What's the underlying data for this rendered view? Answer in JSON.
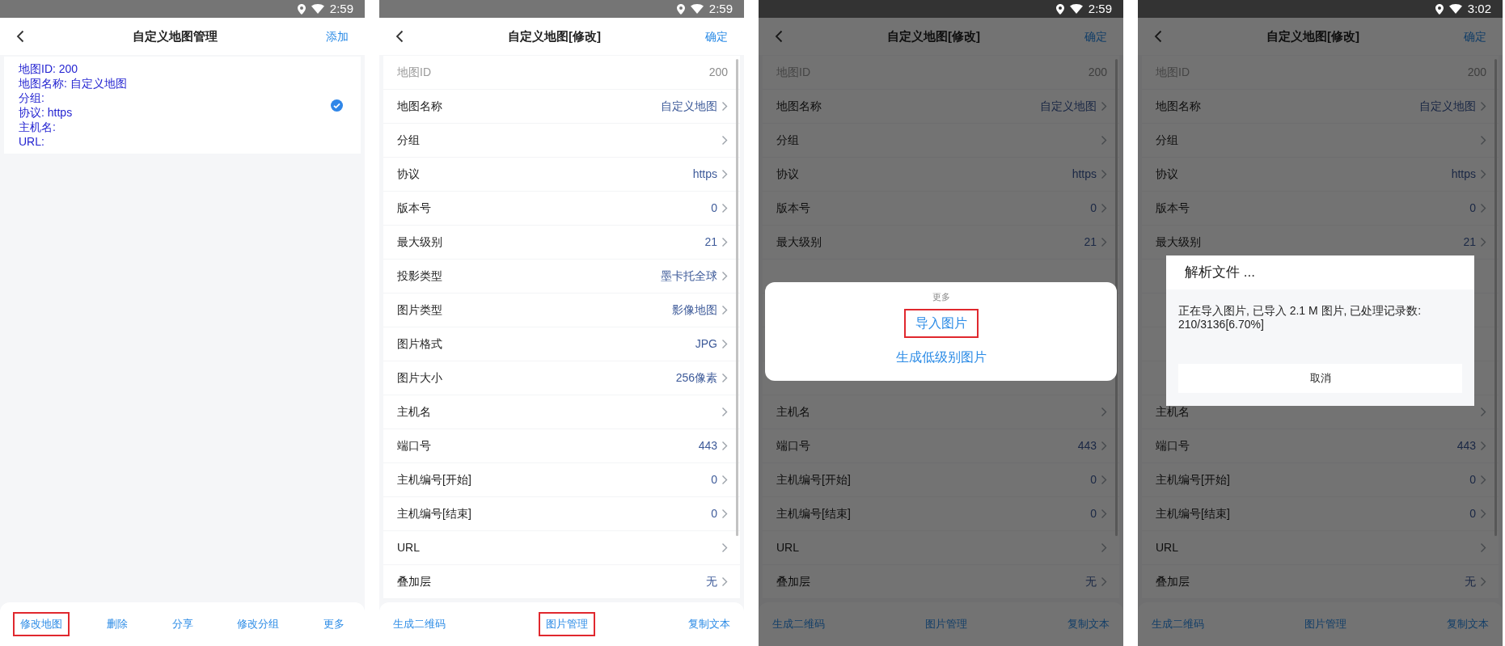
{
  "screens": [
    {
      "kind": "list",
      "dimmed": false,
      "status_bar": {
        "time": "2:59"
      },
      "header": {
        "title": "自定义地图管理",
        "action": "添加"
      },
      "card": {
        "lines": [
          "地图ID: 200",
          "地图名称: 自定义地图",
          "分组:",
          "协议: https",
          "主机名:",
          "URL:"
        ],
        "checked": true
      },
      "bottom_bar": [
        {
          "label": "修改地图",
          "highlighted": true
        },
        {
          "label": "删除",
          "highlighted": false
        },
        {
          "label": "分享",
          "highlighted": false
        },
        {
          "label": "修改分组",
          "highlighted": false
        },
        {
          "label": "更多",
          "highlighted": false
        }
      ]
    },
    {
      "kind": "edit",
      "dimmed": false,
      "status_bar": {
        "time": "2:59"
      },
      "header": {
        "title": "自定义地图[修改]",
        "action": "确定"
      },
      "rows": [
        {
          "kind": "readonly",
          "label": "地图ID",
          "value": "200"
        },
        {
          "kind": "link",
          "label": "地图名称",
          "value": "自定义地图"
        },
        {
          "kind": "link",
          "label": "分组"
        },
        {
          "kind": "link",
          "label": "协议",
          "value": "https"
        },
        {
          "kind": "link",
          "label": "版本号",
          "value": "0"
        },
        {
          "kind": "link",
          "label": "最大级别",
          "value": "21"
        },
        {
          "kind": "link",
          "label": "投影类型",
          "value": "墨卡托全球"
        },
        {
          "kind": "link",
          "label": "图片类型",
          "value": "影像地图"
        },
        {
          "kind": "link",
          "label": "图片格式",
          "value": "JPG"
        },
        {
          "kind": "link",
          "label": "图片大小",
          "value": "256像素"
        },
        {
          "kind": "link",
          "label": "主机名"
        },
        {
          "kind": "link",
          "label": "端口号",
          "value": "443"
        },
        {
          "kind": "link",
          "label": "主机编号[开始]",
          "value": "0"
        },
        {
          "kind": "link",
          "label": "主机编号[结束]",
          "value": "0"
        },
        {
          "kind": "link",
          "label": "URL"
        },
        {
          "kind": "link",
          "label": "叠加层",
          "value": "无"
        }
      ],
      "bottom_bar": [
        {
          "label": "生成二维码",
          "highlighted": false
        },
        {
          "label": "图片管理",
          "highlighted": true
        },
        {
          "label": "复制文本",
          "highlighted": false
        }
      ]
    },
    {
      "kind": "edit",
      "dimmed": true,
      "status_bar": {
        "time": "2:59"
      },
      "header": {
        "title": "自定义地图[修改]",
        "action": "确定"
      },
      "rows": [
        {
          "kind": "readonly",
          "label": "地图ID",
          "value": "200"
        },
        {
          "kind": "link",
          "label": "地图名称",
          "value": "自定义地图"
        },
        {
          "kind": "link",
          "label": "分组"
        },
        {
          "kind": "link",
          "label": "协议",
          "value": "https"
        },
        {
          "kind": "link",
          "label": "版本号",
          "value": "0"
        },
        {
          "kind": "link",
          "label": "最大级别",
          "value": "21"
        },
        {
          "kind": "covered"
        },
        {
          "kind": "covered"
        },
        {
          "kind": "covered"
        },
        {
          "kind": "covered"
        },
        {
          "kind": "link",
          "label": "主机名"
        },
        {
          "kind": "link",
          "label": "端口号",
          "value": "443"
        },
        {
          "kind": "link",
          "label": "主机编号[开始]",
          "value": "0"
        },
        {
          "kind": "link",
          "label": "主机编号[结束]",
          "value": "0"
        },
        {
          "kind": "link",
          "label": "URL"
        },
        {
          "kind": "link",
          "label": "叠加层",
          "value": "无"
        }
      ],
      "bottom_bar": [
        {
          "label": "生成二维码",
          "highlighted": false
        },
        {
          "label": "图片管理",
          "highlighted": false
        },
        {
          "label": "复制文本",
          "highlighted": false
        }
      ],
      "sheet": {
        "title": "更多",
        "items": [
          {
            "label": "导入图片",
            "highlighted": true
          },
          {
            "label": "生成低级别图片",
            "highlighted": false
          }
        ]
      }
    },
    {
      "kind": "edit",
      "dimmed": true,
      "status_bar": {
        "time": "3:02"
      },
      "header": {
        "title": "自定义地图[修改]",
        "action": "确定"
      },
      "rows": [
        {
          "kind": "readonly",
          "label": "地图ID",
          "value": "200"
        },
        {
          "kind": "link",
          "label": "地图名称",
          "value": "自定义地图"
        },
        {
          "kind": "link",
          "label": "分组"
        },
        {
          "kind": "link",
          "label": "协议",
          "value": "https"
        },
        {
          "kind": "link",
          "label": "版本号",
          "value": "0"
        },
        {
          "kind": "link",
          "label": "最大级别",
          "value": "21"
        },
        {
          "kind": "covered"
        },
        {
          "kind": "covered"
        },
        {
          "kind": "covered"
        },
        {
          "kind": "covered"
        },
        {
          "kind": "link",
          "label": "主机名"
        },
        {
          "kind": "link",
          "label": "端口号",
          "value": "443"
        },
        {
          "kind": "link",
          "label": "主机编号[开始]",
          "value": "0"
        },
        {
          "kind": "link",
          "label": "主机编号[结束]",
          "value": "0"
        },
        {
          "kind": "link",
          "label": "URL"
        },
        {
          "kind": "link",
          "label": "叠加层",
          "value": "无"
        }
      ],
      "bottom_bar": [
        {
          "label": "生成二维码",
          "highlighted": false
        },
        {
          "label": "图片管理",
          "highlighted": false
        },
        {
          "label": "复制文本",
          "highlighted": false
        }
      ],
      "dialog": {
        "title": "解析文件 ...",
        "message": "正在导入图片, 已导入 2.1 M 图片, 已处理记录数: 210/3136[6.70%]",
        "button": "取消"
      }
    }
  ]
}
